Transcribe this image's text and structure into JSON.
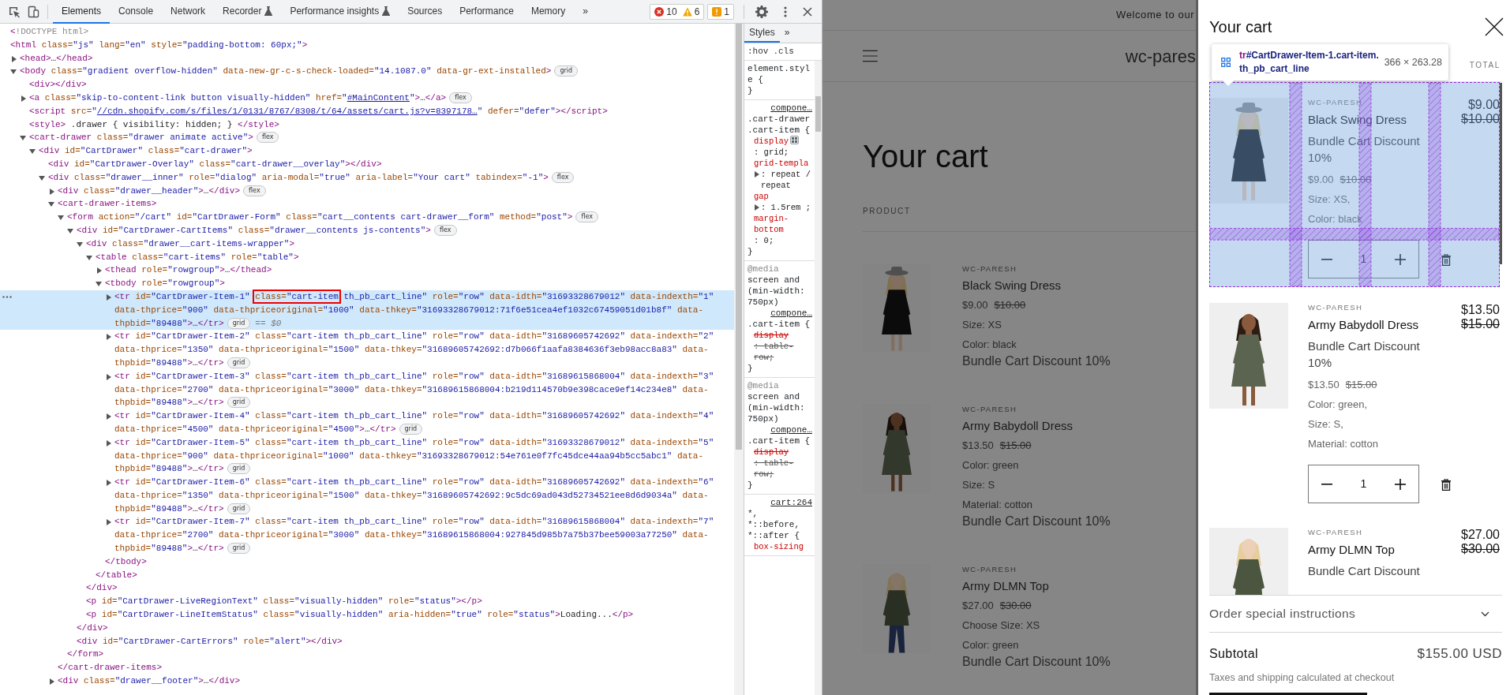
{
  "devtools": {
    "tabs": [
      {
        "label": "Elements",
        "selected": true
      },
      {
        "label": "Console",
        "selected": false
      },
      {
        "label": "Network",
        "selected": false
      },
      {
        "label": "Recorder",
        "selected": false,
        "experimental": true
      },
      {
        "label": "Performance insights",
        "selected": false,
        "experimental": true
      },
      {
        "label": "Sources",
        "selected": false
      },
      {
        "label": "Performance",
        "selected": false
      },
      {
        "label": "Memory",
        "selected": false
      }
    ],
    "more_tabs": "»",
    "counters": [
      {
        "kind": "error",
        "count": "10"
      },
      {
        "kind": "warning",
        "count": "6"
      },
      {
        "kind": "issue",
        "count": "1"
      }
    ],
    "elements": {
      "nodes": [
        {
          "open": "<!DOCTYPE html>",
          "selected": false
        },
        {
          "open": "<html class=\"js\" lang=\"en\" style=\"padding-bottom: 60px;\">",
          "selected": false,
          "children": [
            {
              "open": "<head>…</head>",
              "expanded": false,
              "selected": false
            },
            {
              "open": "<body class=\"gradient overflow-hidden\" data-new-gr-c-s-check-loaded=\"14.1087.0\" data-gr-ext-installed>",
              "badge": "grid",
              "expanded": true,
              "selected": false,
              "children": [
                {
                  "open": "<div></div>",
                  "selected": false
                },
                {
                  "open": [
                    {
                      "text": "<a class=\"skip-to-content-link button visually-hidden\" href=\""
                    },
                    {
                      "text": "#MainContent",
                      "kind": "link"
                    },
                    {
                      "text": "\">…</a>"
                    }
                  ],
                  "badge": "flex",
                  "expanded": false,
                  "selected": false
                },
                {
                  "open": [
                    {
                      "text": "<script src=\""
                    },
                    {
                      "text": "//cdn.shopify.com/s/files/1/0131/8767/8308/t/64/assets/cart.js?v=8397178…",
                      "kind": "link"
                    },
                    {
                      "text": "\" defer=\"defer\"></script>"
                    }
                  ],
                  "selected": false
                },
                {
                  "open": "<style> .drawer { visibility: hidden; } </style>",
                  "selected": false
                },
                {
                  "open": "<cart-drawer class=\"drawer animate active\">",
                  "badge": "flex",
                  "expanded": true,
                  "selected": false,
                  "children": [
                    {
                      "open": "<div id=\"CartDrawer\" class=\"cart-drawer\">",
                      "expanded": true,
                      "selected": false,
                      "children": [
                        {
                          "open": "<div id=\"CartDrawer-Overlay\" class=\"cart-drawer__overlay\"></div>",
                          "selected": false
                        },
                        {
                          "open": "<div class=\"drawer__inner\" role=\"dialog\" aria-modal=\"true\" aria-label=\"Your cart\" tabindex=\"-1\">",
                          "badge": "flex",
                          "expanded": true,
                          "selected": false,
                          "children": [
                            {
                              "open": "<div class=\"drawer__header\">…</div>",
                              "badge": "flex",
                              "expanded": false,
                              "selected": false
                            },
                            {
                              "open": "<cart-drawer-items>",
                              "expanded": true,
                              "selected": false,
                              "close": "</cart-drawer-items>",
                              "children": [
                                {
                                  "open": "<form action=\"/cart\" id=\"CartDrawer-Form\" class=\"cart__contents cart-drawer__form\" method=\"post\">",
                                  "badge": "flex",
                                  "expanded": true,
                                  "selected": false,
                                  "close": "</form>",
                                  "children": [
                                    {
                                      "open": "<div id=\"CartDrawer-CartItems\" class=\"drawer__contents js-contents\">",
                                      "badge": "flex",
                                      "expanded": true,
                                      "selected": false,
                                      "close": "</div>",
                                      "children": [
                                        {
                                          "open": "<div class=\"drawer__cart-items-wrapper\">",
                                          "expanded": true,
                                          "selected": false,
                                          "close": "</div>",
                                          "children": [
                                            {
                                              "open": "<table class=\"cart-items\" role=\"table\">",
                                              "expanded": true,
                                              "selected": false,
                                              "close": "</table>",
                                              "children": [
                                                {
                                                  "open": "<thead role=\"rowgroup\">…</thead>",
                                                  "expanded": false,
                                                  "selected": false
                                                },
                                                {
                                                  "open": "<tbody role=\"rowgroup\">",
                                                  "expanded": true,
                                                  "selected": false,
                                                  "close": "</tbody>",
                                                  "children": [
                                                    {
                                                      "open": [
                                                        {
                                                          "text": "<tr id=\"CartDrawer-Item-1\" "
                                                        },
                                                        {
                                                          "text": "class=\"cart-item",
                                                          "kind": "boxed"
                                                        },
                                                        {
                                                          "text": " th_pb_cart_line\" role=\"row\" data-idth=\"31693328679012\" data-indexth=\"1\" data-thprice=\"900\" data-thpriceoriginal=\"1000\" data-thkey=\"31693328679012:71f6e51cea4ef1032c67459051d01b8f\" data-thpbid=\"89488\">…</tr>"
                                                        }
                                                      ],
                                                      "badge": "grid",
                                                      "console_ref": "== $0",
                                                      "expanded": false,
                                                      "selected": true
                                                    },
                                                    {
                                                      "open": "<tr id=\"CartDrawer-Item-2\" class=\"cart-item th_pb_cart_line\" role=\"row\" data-idth=\"31689605742692\" data-indexth=\"2\" data-thprice=\"1350\" data-thpriceoriginal=\"1500\" data-thkey=\"31689605742692:d7b066f1aafa8384636f3eb98acc8a83\" data-thpbid=\"89488\">…</tr>",
                                                      "badge": "grid",
                                                      "expanded": false,
                                                      "selected": false
                                                    },
                                                    {
                                                      "open": "<tr id=\"CartDrawer-Item-3\" class=\"cart-item th_pb_cart_line\" role=\"row\" data-idth=\"31689615868004\" data-indexth=\"3\" data-thprice=\"2700\" data-thpriceoriginal=\"3000\" data-thkey=\"31689615868004:b219d114570b9e398cace9ef14c234e8\" data-thpbid=\"89488\">…</tr>",
                                                      "badge": "grid",
                                                      "expanded": false,
                                                      "selected": false
                                                    },
                                                    {
                                                      "open": "<tr id=\"CartDrawer-Item-4\" class=\"cart-item th_pb_cart_line\" role=\"row\" data-idth=\"31689605742692\" data-indexth=\"4\" data-thprice=\"4500\" data-thpriceoriginal=\"4500\">…</tr>",
                                                      "badge": "grid",
                                                      "expanded": false,
                                                      "selected": false
                                                    },
                                                    {
                                                      "open": "<tr id=\"CartDrawer-Item-5\" class=\"cart-item th_pb_cart_line\" role=\"row\" data-idth=\"31693328679012\" data-indexth=\"5\" data-thprice=\"900\" data-thpriceoriginal=\"1000\" data-thkey=\"31693328679012:54e761e0f7fc45dce44aa94b5cc5abc1\" data-thpbid=\"89488\">…</tr>",
                                                      "badge": "grid",
                                                      "expanded": false,
                                                      "selected": false
                                                    },
                                                    {
                                                      "open": "<tr id=\"CartDrawer-Item-6\" class=\"cart-item th_pb_cart_line\" role=\"row\" data-idth=\"31689605742692\" data-indexth=\"6\" data-thprice=\"1350\" data-thpriceoriginal=\"1500\" data-thkey=\"31689605742692:9c5dc69ad043d52734521ee8d6d9034a\" data-thpbid=\"89488\">…</tr>",
                                                      "badge": "grid",
                                                      "expanded": false,
                                                      "selected": false
                                                    },
                                                    {
                                                      "open": "<tr id=\"CartDrawer-Item-7\" class=\"cart-item th_pb_cart_line\" role=\"row\" data-idth=\"31689615868004\" data-indexth=\"7\" data-thprice=\"2700\" data-thpriceoriginal=\"3000\" data-thkey=\"31689615868004:927845d985b7a75b37bee59003a77250\" data-thpbid=\"89488\">…</tr>",
                                                      "badge": "grid",
                                                      "expanded": false,
                                                      "selected": false
                                                    }
                                                  ]
                                                }
                                              ]
                                            }
                                          ]
                                        },
                                        {
                                          "open": "<p id=\"CartDrawer-LiveRegionText\" class=\"visually-hidden\" role=\"status\"></p>",
                                          "selected": false
                                        },
                                        {
                                          "open": "<p id=\"CartDrawer-LineItemStatus\" class=\"visually-hidden\" aria-hidden=\"true\" role=\"status\">Loading...</p>",
                                          "selected": false
                                        }
                                      ]
                                    },
                                    {
                                      "open": "<div id=\"CartDrawer-CartErrors\" role=\"alert\"></div>",
                                      "selected": false
                                    }
                                  ]
                                }
                              ]
                            },
                            {
                              "open": "<div class=\"drawer__footer\">…</div>",
                              "expanded": false,
                              "selected": false
                            }
                          ]
                        }
                      ]
                    }
                  ]
                }
              ]
            }
          ]
        }
      ]
    },
    "styles": {
      "tabs": [
        {
          "label": "Styles",
          "selected": true
        }
      ],
      "more_tabs": "»",
      "filters": [
        ":hov",
        ".cls"
      ],
      "rules": [
        {
          "selector": "element.style {",
          "close": "}"
        },
        {
          "source": "compone…",
          "selector": ".cart-drawer .cart-item {",
          "close": "}",
          "declarations": [
            {
              "name": "display",
              "value": ": grid;",
              "grid_editor": true,
              "overridden": false
            },
            {
              "name": "grid-templa",
              "value": ": repeat / repeat",
              "expandable": true,
              "overridden": false
            },
            {
              "name": "gap",
              "value": ": 1.5rem ;",
              "expandable": true,
              "overridden": false
            },
            {
              "name": "margin-bottom",
              "value": ": 0;",
              "overridden": false
            }
          ]
        },
        {
          "media_keyword": "@media",
          "media": "screen and (min-width: 750px)",
          "source": "compone…",
          "selector": ".cart-item {",
          "close": "}",
          "declarations": [
            {
              "name": "display",
              "value": ": table-row;",
              "overridden": true
            }
          ]
        },
        {
          "media_keyword": "@media",
          "media": "screen and (min-width: 750px)",
          "source": "compone…",
          "selector": ".cart-item {",
          "close": "}",
          "declarations": [
            {
              "name": "display",
              "value": ": table-row;",
              "overridden": true
            }
          ]
        },
        {
          "source": "cart:264",
          "selector": "*, *::before, *::after {",
          "declarations": [
            {
              "name": "box-sizing",
              "overridden": false
            }
          ]
        }
      ]
    }
  },
  "storefront": {
    "announcement": "Welcome to our",
    "logo": "wc-pares",
    "title": "Your cart",
    "column_header": "PRODUCT",
    "items": [
      {
        "vendor": "WC-PARESH",
        "name": "Black Swing Dress",
        "price": "$9.00",
        "compare_price": "$10.00",
        "options": [
          "Size: XS",
          "Color: black"
        ],
        "discount": "Bundle Cart Discount 10%"
      },
      {
        "vendor": "WC-PARESH",
        "name": "Army Babydoll Dress",
        "price": "$13.50",
        "compare_price": "$15.00",
        "options": [
          "Color: green",
          "Size: S",
          "Material: cotton"
        ],
        "discount": "Bundle Cart Discount 10%"
      },
      {
        "vendor": "WC-PARESH",
        "name": "Army DLMN Top",
        "price": "$27.00",
        "compare_price": "$30.00",
        "options": [
          "Choose Size: XS",
          "Color: green"
        ],
        "discount": "Bundle Cart Discount 10%"
      }
    ]
  },
  "drawer": {
    "title": "Your cart",
    "inspect_tooltip": {
      "tag": "tr",
      "selector": "#CartDrawer-Item-1.cart-item.th_pb_cart_line",
      "size": "366 × 263.28"
    },
    "column_header": "TOTAL",
    "items": [
      {
        "vendor": "WC-PARESH",
        "name": "Black Swing Dress",
        "discount": "Bundle Cart Discount 10%",
        "price": "$9.00",
        "compare_price": "$10.00",
        "options": [
          "Size: XS,",
          "Color: black"
        ],
        "quantity": "1",
        "total": "$9.00",
        "total_compare": "$10.00",
        "highlighted": true
      },
      {
        "vendor": "WC-PARESH",
        "name": "Army Babydoll Dress",
        "discount": "Bundle Cart Discount 10%",
        "price": "$13.50",
        "compare_price": "$15.00",
        "options": [
          "Color: green,",
          "Size: S,",
          "Material: cotton"
        ],
        "quantity": "1",
        "total": "$13.50",
        "total_compare": "$15.00"
      },
      {
        "vendor": "WC-PARESH",
        "name": "Army DLMN Top",
        "discount": "Bundle Cart Discount",
        "total": "$27.00",
        "total_compare": "$30.00"
      }
    ],
    "instructions": {
      "label": "Order special instructions",
      "expanded": false
    },
    "subtotal_label": "Subtotal",
    "subtotal": "$155.00 USD",
    "tax_note": "Taxes and shipping calculated at checkout"
  }
}
